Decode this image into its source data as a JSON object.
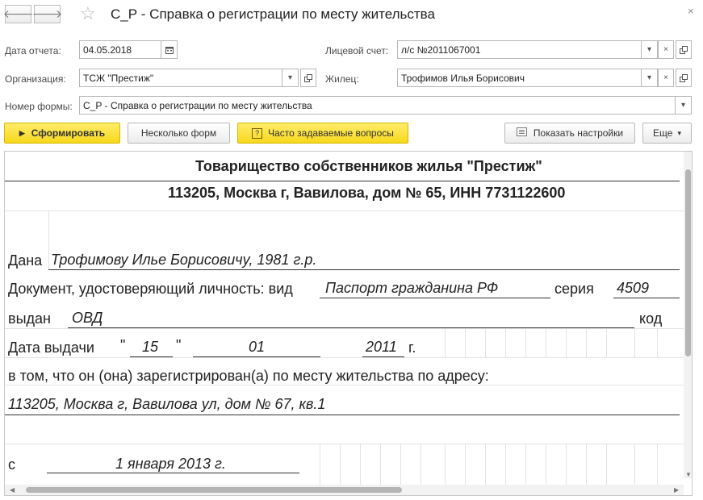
{
  "window": {
    "title": "С_Р - Справка о регистрации по месту жительства",
    "back_glyph": "🡐",
    "forward_glyph": "🡒",
    "close_glyph": "×"
  },
  "form": {
    "report_date_label": "Дата отчета:",
    "report_date_value": "04.05.2018",
    "account_label": "Лицевой счет:",
    "account_value": "л/с №2011067001",
    "org_label": "Организация:",
    "org_value": "ТСЖ \"Престиж\"",
    "resident_label": "Жилец:",
    "resident_value": "Трофимов Илья Борисович",
    "form_number_label": "Номер формы:",
    "form_number_value": "С_Р - Справка о регистрации по месту жительства"
  },
  "toolbar": {
    "generate_label": "Сформировать",
    "several_forms_label": "Несколько форм",
    "faq_label": "Часто задаваемые вопросы",
    "show_settings_label": "Показать настройки",
    "more_label": "Еще"
  },
  "report": {
    "org_name": "Товарищество собственников жилья \"Престиж\"",
    "org_address": "113205, Москва г, Вавилова, дом № 65, ИНН 7731122600",
    "issued_to_label": "Дана",
    "issued_to_value": "Трофимову Илье Борисовичу, 1981 г.р.",
    "id_doc_label": "Документ, удостоверяющий личность: вид",
    "id_doc_value": "Паспорт гражданина РФ",
    "series_label": "серия",
    "series_value": "4509",
    "issued_by_label": "выдан",
    "issued_by_value": "ОВД",
    "code_label": "код",
    "issue_date_label": "Дата выдачи",
    "quote_open": "\"",
    "issue_day": "15",
    "quote_close": "\"",
    "issue_month": "01",
    "issue_year": "2011",
    "year_suffix": "г.",
    "registered_text": "в том, что он (она) зарегистрирован(а) по месту жительства по адресу:",
    "address_value": "113205, Москва г, Вавилова ул, дом № 67, кв.1",
    "since_label": "с",
    "since_value": "1 января 2013 г."
  }
}
